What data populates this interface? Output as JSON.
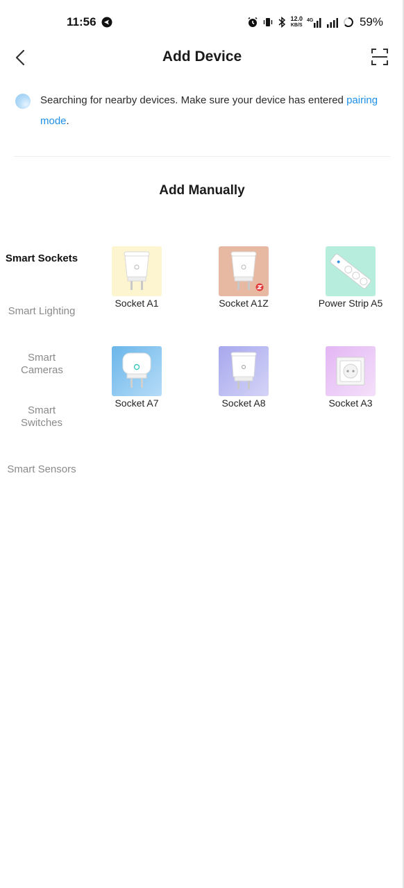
{
  "status_bar": {
    "time": "11:56",
    "speed_value": "12.0",
    "speed_unit": "KB/S",
    "network": "4G",
    "battery": "59%"
  },
  "header": {
    "title": "Add Device"
  },
  "search": {
    "text": "Searching for nearby devices. Make sure your device has entered ",
    "link": "pairing mode",
    "suffix": "."
  },
  "section": {
    "title": "Add Manually"
  },
  "categories": [
    {
      "label": "Smart Sockets",
      "active": true
    },
    {
      "label": "Smart Lighting",
      "active": false
    },
    {
      "label": "Smart Cameras",
      "active": false
    },
    {
      "label": "Smart Switches",
      "active": false
    },
    {
      "label": "Smart Sensors",
      "active": false
    }
  ],
  "devices": [
    {
      "label": "Socket A1",
      "bg": "#fdf5cf"
    },
    {
      "label": "Socket A1Z",
      "bg": "#e8b9a2"
    },
    {
      "label": "Power Strip A5",
      "bg": "#b6eddd"
    },
    {
      "label": "Socket A7",
      "bg": "#86c6ef"
    },
    {
      "label": "Socket A8",
      "bg": "#bcbcf2"
    },
    {
      "label": "Socket A3",
      "bg": "#e9c6f5"
    }
  ],
  "colors": {
    "accent": "#1e8fe8",
    "active_category": "#111111",
    "inactive_category": "#8a8a8a"
  }
}
